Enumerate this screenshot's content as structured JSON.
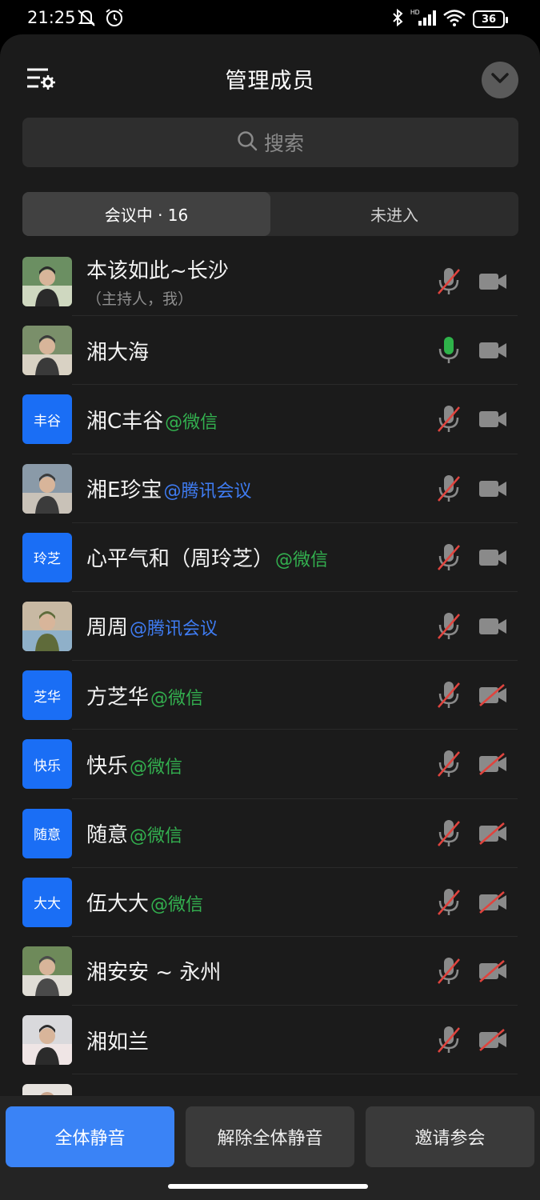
{
  "status_bar": {
    "time": "21:25",
    "battery": "36",
    "icons": [
      "mute-bell-icon",
      "alarm-icon",
      "bluetooth-icon",
      "signal-hd-icon",
      "wifi-icon",
      "battery-icon"
    ]
  },
  "header": {
    "title": "管理成员",
    "settings_icon": "list-settings-icon",
    "collapse_icon": "chevron-down-icon"
  },
  "search": {
    "placeholder": "搜索"
  },
  "tabs": [
    {
      "label": "会议中 · 16",
      "active": true
    },
    {
      "label": "未进入",
      "active": false
    }
  ],
  "members": [
    {
      "name": "本该如此~长沙",
      "tag": "",
      "sub": "（主持人，我）",
      "avatar": "photo",
      "mic": "muted",
      "camera": "off-visible"
    },
    {
      "name": "湘大海",
      "tag": "",
      "sub": "",
      "avatar": "photo",
      "mic": "active",
      "camera": "off-visible"
    },
    {
      "name": "湘C丰谷",
      "tag": "@微信",
      "tag_color": "green",
      "avatar": "丰谷",
      "mic": "muted",
      "camera": "off-visible"
    },
    {
      "name": "湘E珍宝",
      "tag": "@腾讯会议",
      "tag_color": "blue",
      "avatar": "photo",
      "mic": "muted",
      "camera": "off-visible"
    },
    {
      "name": "心平气和（周玲芝）",
      "tag": "@微信",
      "tag_color": "green",
      "avatar": "玲芝",
      "mic": "muted",
      "camera": "off-visible"
    },
    {
      "name": "周周",
      "tag": "@腾讯会议",
      "tag_color": "blue",
      "avatar": "photo",
      "mic": "muted",
      "camera": "off-visible"
    },
    {
      "name": "方芝华",
      "tag": "@微信",
      "tag_color": "green",
      "avatar": "芝华",
      "mic": "muted",
      "camera": "disabled"
    },
    {
      "name": "快乐",
      "tag": "@微信",
      "tag_color": "green",
      "avatar": "快乐",
      "mic": "muted",
      "camera": "disabled"
    },
    {
      "name": "随意",
      "tag": "@微信",
      "tag_color": "green",
      "avatar": "随意",
      "mic": "muted",
      "camera": "disabled"
    },
    {
      "name": "伍大大",
      "tag": "@微信",
      "tag_color": "green",
      "avatar": "大大",
      "mic": "muted",
      "camera": "disabled"
    },
    {
      "name": "湘安安 ~ 永州",
      "tag": "",
      "avatar": "photo",
      "mic": "muted",
      "camera": "disabled"
    },
    {
      "name": "湘如兰",
      "tag": "",
      "avatar": "photo",
      "mic": "muted",
      "camera": "disabled"
    }
  ],
  "actions": {
    "mute_all": "全体静音",
    "unmute_all": "解除全体静音",
    "invite": "邀请参会"
  },
  "colors": {
    "accent_blue": "#3a83f6",
    "wechat_green": "#33b04f",
    "tencent_blue": "#3f7cf2",
    "muted_red": "#e0443e",
    "mic_active": "#2fb34a"
  }
}
